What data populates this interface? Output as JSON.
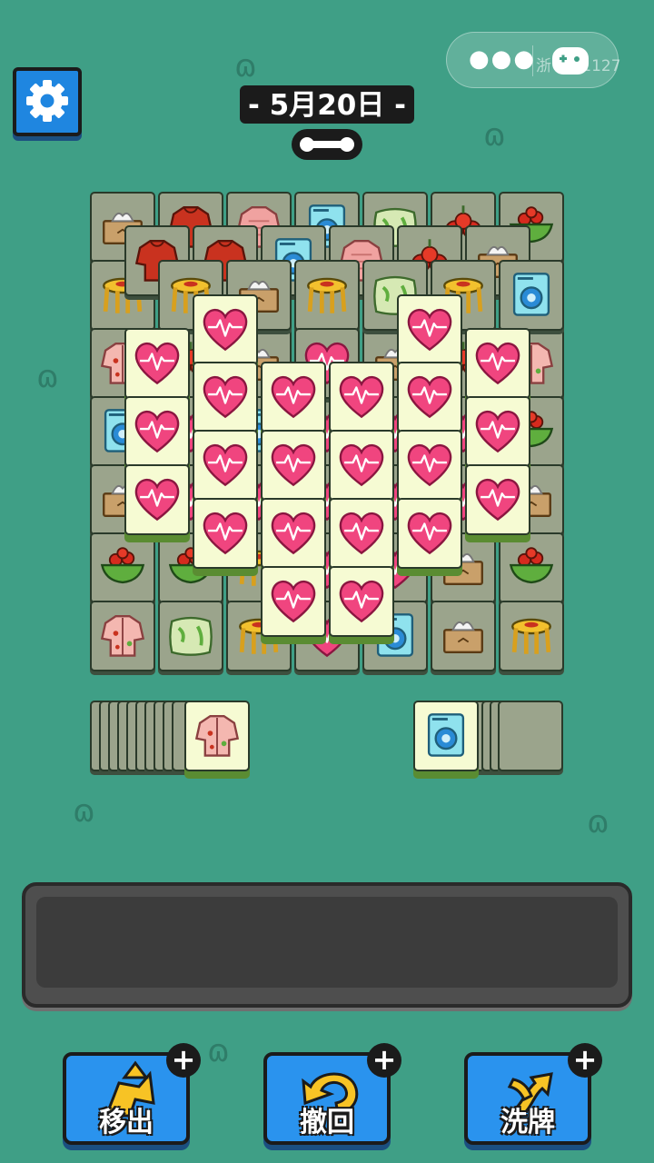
{
  "header": {
    "date_banner": "- 5月20日 -",
    "capsule_menu_icon": "more-dots-icon",
    "capsule_game_icon": "gamepad-icon",
    "capsule_partial_text": "浙    4A:1127",
    "settings_icon": "gear-icon"
  },
  "board": {
    "bottom_layer": [
      [
        "tissue-box",
        "sweater",
        "knit-sweater",
        "washing-machine",
        "pillow",
        "cherries",
        "cherries-bowl"
      ],
      [
        "stool",
        "sweater",
        "knit-sweater",
        "washing-machine",
        "knit-sweater",
        "cherries-bowl",
        "pillow"
      ],
      [
        "hawaiian-shirt",
        "cherries",
        "tissue-box",
        "heart",
        "tissue-box",
        "cherries",
        "hawaiian-shirt"
      ],
      [
        "washing-machine",
        "heart",
        "washing-machine",
        "heart",
        "heart",
        "heart",
        "cherries-bowl"
      ],
      [
        "tissue-box",
        "heart",
        "heart",
        "heart",
        "heart",
        "heart",
        "tissue-box"
      ],
      [
        "cherries-bowl",
        "cherries-bowl",
        "stool",
        "heart",
        "heart",
        "tissue-box",
        "cherries-bowl"
      ],
      [
        "hawaiian-shirt",
        "pillow",
        "stool",
        "heart",
        "washing-machine",
        "tissue-box",
        "stool"
      ]
    ],
    "upper_layer_label": "pulse-heart",
    "upper_layer_count": 21
  },
  "stacks": {
    "left_top_tile": "hawaiian-shirt",
    "left_count": 10,
    "right_top_tile": "washing-machine",
    "right_count": 10
  },
  "tray": {
    "slots": []
  },
  "powerups": [
    {
      "label": "移出",
      "icon": "move-out-icon",
      "badge": "+"
    },
    {
      "label": "撤回",
      "icon": "undo-icon",
      "badge": "+"
    },
    {
      "label": "洗牌",
      "icon": "shuffle-icon",
      "badge": "+"
    }
  ],
  "colors": {
    "background": "#3f9f86",
    "accent_blue": "#2a93ee",
    "tile_face_lit": "#f6fbd3",
    "tile_face_dim": "#9ba48c",
    "heart_pink": "#f0457f"
  }
}
